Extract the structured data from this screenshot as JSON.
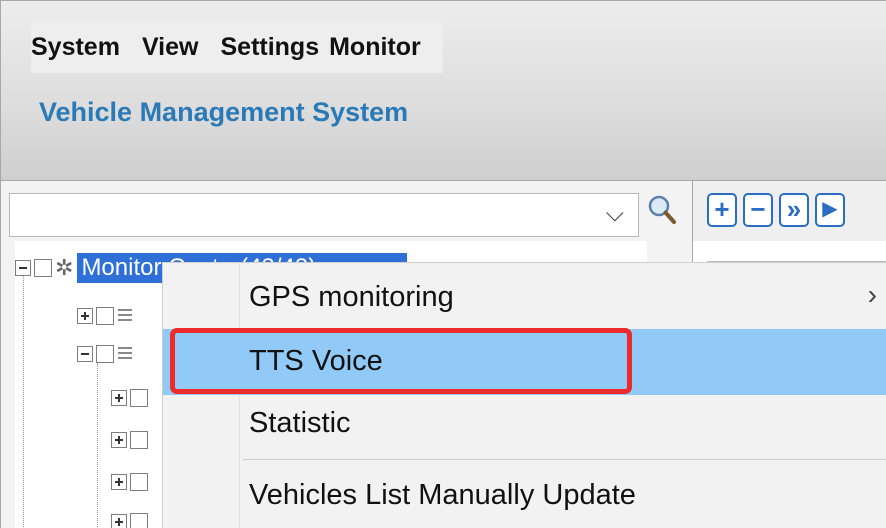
{
  "menu_bar": {
    "items": [
      {
        "label": "System"
      },
      {
        "label": "View"
      },
      {
        "label": "Settings"
      },
      {
        "label": "Monitor"
      }
    ]
  },
  "app": {
    "title": "Vehicle Management System"
  },
  "vehicle_tree": {
    "search": {
      "value": ""
    },
    "root_label": "Monitor Center(43/43)"
  },
  "map_toolbar": {
    "buttons": [
      {
        "icon": "zoom-in-icon",
        "glyph": "+"
      },
      {
        "icon": "zoom-out-icon",
        "glyph": "−"
      },
      {
        "icon": "pan-icon",
        "glyph": "»"
      },
      {
        "icon": "flag-icon",
        "glyph": "▶"
      }
    ]
  },
  "context_menu": {
    "items": [
      {
        "label": "GPS monitoring",
        "has_submenu": true,
        "submenu_glyph": "›"
      },
      {
        "label": "TTS Voice",
        "highlighted": true
      },
      {
        "label": "Statistic"
      },
      {
        "label": "Vehicles List Manually Update"
      }
    ]
  },
  "colors": {
    "title": "#2a7ab8",
    "selection": "#2e6fd8",
    "menu_highlight": "#91c9f7",
    "annotation": "#ee2b2b"
  }
}
